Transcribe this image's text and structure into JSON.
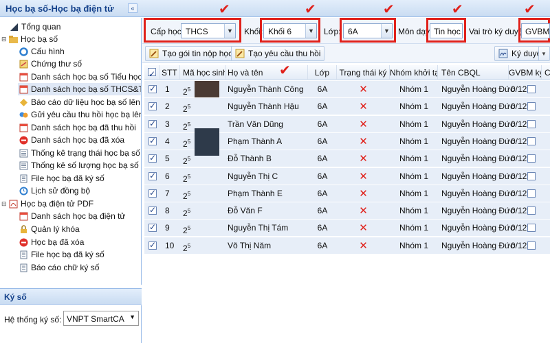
{
  "window": {
    "title": "Học bạ số-Học bạ điện tử",
    "collapse_icon": "chevrons-left-icon"
  },
  "sidebar": {
    "items": [
      {
        "label": "Tổng quan",
        "icon": "chart-icon",
        "level": 1
      },
      {
        "label": "Học bạ số",
        "icon": "folder-icon",
        "level": 0
      },
      {
        "label": "Cấu hình",
        "icon": "settings-icon",
        "level": 1
      },
      {
        "label": "Chứng thư số",
        "icon": "certificate-icon",
        "level": 1
      },
      {
        "label": "Danh sách học bạ số Tiểu học",
        "icon": "calendar-list-icon",
        "level": 1
      },
      {
        "label": "Danh sách học bạ số THCS&THPT",
        "icon": "calendar-list-icon",
        "level": 1,
        "selected": true
      },
      {
        "label": "Báo cáo dữ liệu học bạ số lên Bộ",
        "icon": "report-icon",
        "level": 1
      },
      {
        "label": "Gửi yêu cầu thu hồi học bạ lên Bộ",
        "icon": "send-icon",
        "level": 1
      },
      {
        "label": "Danh sách học bạ đã thu hồi",
        "icon": "calendar-list-icon",
        "level": 1
      },
      {
        "label": "Danh sách học bạ đã xóa",
        "icon": "delete-icon",
        "level": 1
      },
      {
        "label": "Thống kê trạng thái học bạ số",
        "icon": "stats-icon",
        "level": 1
      },
      {
        "label": "Thống kê số lượng học bạ số",
        "icon": "stats-icon",
        "level": 1
      },
      {
        "label": "File học bạ đã ký số",
        "icon": "file-icon",
        "level": 1
      },
      {
        "label": "Lịch sử đồng bộ",
        "icon": "sync-icon",
        "level": 1
      },
      {
        "label": "Học bạ điện tử PDF",
        "icon": "pdf-icon",
        "level": 0
      },
      {
        "label": "Danh sách học bạ điện tử",
        "icon": "calendar-list-icon",
        "level": 1
      },
      {
        "label": "Quản lý khóa",
        "icon": "lock-icon",
        "level": 1
      },
      {
        "label": "Học bạ đã xóa",
        "icon": "delete-icon",
        "level": 1
      },
      {
        "label": "File học bạ đã ký số",
        "icon": "file-icon",
        "level": 1
      },
      {
        "label": "Báo cáo chữ ký số",
        "icon": "file-icon",
        "level": 1
      }
    ]
  },
  "kyso": {
    "title": "Ký số",
    "system_label": "Hệ thống ký số:",
    "system_value": "VNPT SmartCA"
  },
  "filters": {
    "cap_hoc_label": "Cấp học:",
    "cap_hoc_value": "THCS",
    "khoi_label": "Khối:",
    "khoi_value": "Khối 6",
    "lop_label": "Lớp:",
    "lop_value": "6A",
    "mon_day_label": "Môn dạy:",
    "mon_day_value": "Tin học",
    "vai_tro_label": "Vai trò ký duyệt:",
    "vai_tro_value": "GVBM",
    "highlight_color": "#e0201a"
  },
  "toolbar": {
    "create_package": "Tạo gói tin nộp học bạ",
    "create_request": "Tạo yêu cầu thu hồi",
    "sign_approve": "Ký duyệt"
  },
  "table": {
    "columns": [
      "STT",
      "Mã học sinh",
      "Họ và tên",
      "Lớp",
      "Trạng thái ký",
      "Nhóm khởi tạo",
      "Tên CBQL",
      "GVBM ký",
      "C"
    ],
    "rows": [
      {
        "stt": "1",
        "ma": "2",
        "sup": "5",
        "name": "Nguyễn Thành Công",
        "lop": "6A",
        "status": "✕",
        "nhom": "Nhóm 1",
        "cbql": "Nguyễn Hoàng Đức",
        "gvbm": "0/12"
      },
      {
        "stt": "2",
        "ma": "2",
        "sup": "5",
        "name": "Nguyễn Thành Hậu",
        "lop": "6A",
        "status": "✕",
        "nhom": "Nhóm 1",
        "cbql": "Nguyễn Hoàng Đức",
        "gvbm": "0/12"
      },
      {
        "stt": "3",
        "ma": "2",
        "sup": "5",
        "name": "Trần Văn Dũng",
        "lop": "6A",
        "status": "✕",
        "nhom": "Nhóm 1",
        "cbql": "Nguyễn Hoàng Đức",
        "gvbm": "0/12"
      },
      {
        "stt": "4",
        "ma": "2",
        "sup": "5",
        "name": "Phạm Thành A",
        "lop": "6A",
        "status": "✕",
        "nhom": "Nhóm 1",
        "cbql": "Nguyễn Hoàng Đức",
        "gvbm": "0/12"
      },
      {
        "stt": "5",
        "ma": "2",
        "sup": "5",
        "name": "Đỗ Thành B",
        "lop": "6A",
        "status": "✕",
        "nhom": "Nhóm 1",
        "cbql": "Nguyễn Hoàng Đức",
        "gvbm": "0/12"
      },
      {
        "stt": "6",
        "ma": "2",
        "sup": "5",
        "name": "Nguyễn Thị C",
        "lop": "6A",
        "status": "✕",
        "nhom": "Nhóm 1",
        "cbql": "Nguyễn Hoàng Đức",
        "gvbm": "0/12"
      },
      {
        "stt": "7",
        "ma": "2",
        "sup": "5",
        "name": "Phạm Thành E",
        "lop": "6A",
        "status": "✕",
        "nhom": "Nhóm 1",
        "cbql": "Nguyễn Hoàng Đức",
        "gvbm": "0/12"
      },
      {
        "stt": "8",
        "ma": "2",
        "sup": "5",
        "name": "Đỗ Văn F",
        "lop": "6A",
        "status": "✕",
        "nhom": "Nhóm 1",
        "cbql": "Nguyễn Hoàng Đức",
        "gvbm": "0/12"
      },
      {
        "stt": "9",
        "ma": "2",
        "sup": "5",
        "name": "Nguyễn Thị Tám",
        "lop": "6A",
        "status": "✕",
        "nhom": "Nhóm 1",
        "cbql": "Nguyễn Hoàng Đức",
        "gvbm": "0/12"
      },
      {
        "stt": "10",
        "ma": "2",
        "sup": "5",
        "name": "Võ Thị Năm",
        "lop": "6A",
        "status": "✕",
        "nhom": "Nhóm 1",
        "cbql": "Nguyễn Hoàng Đức",
        "gvbm": "0/12"
      }
    ]
  }
}
